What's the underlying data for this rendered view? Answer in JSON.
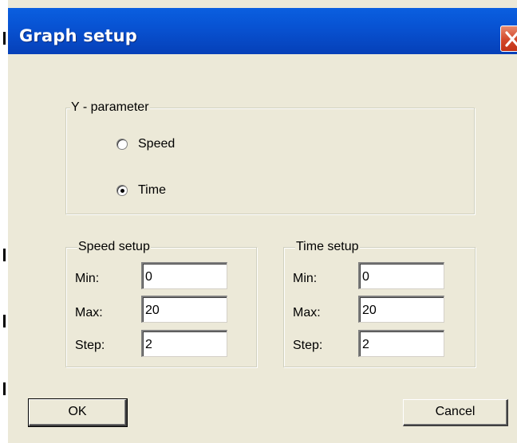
{
  "window": {
    "title": "Graph setup"
  },
  "y_parameter": {
    "label": "Y - parameter",
    "options": [
      {
        "label": "Speed",
        "selected": false
      },
      {
        "label": "Time",
        "selected": true
      }
    ]
  },
  "speed_setup": {
    "label": "Speed setup",
    "fields": [
      {
        "label": "Min:",
        "value": "0"
      },
      {
        "label": "Max:",
        "value": "20"
      },
      {
        "label": "Step:",
        "value": "2"
      }
    ]
  },
  "time_setup": {
    "label": "Time setup",
    "fields": [
      {
        "label": "Min:",
        "value": "0"
      },
      {
        "label": "Max:",
        "value": "20"
      },
      {
        "label": "Step:",
        "value": "2"
      }
    ]
  },
  "buttons": {
    "ok": "OK",
    "cancel": "Cancel"
  },
  "colors": {
    "titlebar": "#0853d3",
    "dialog_background": "#ece9d8",
    "close_button": "#d2472a"
  }
}
